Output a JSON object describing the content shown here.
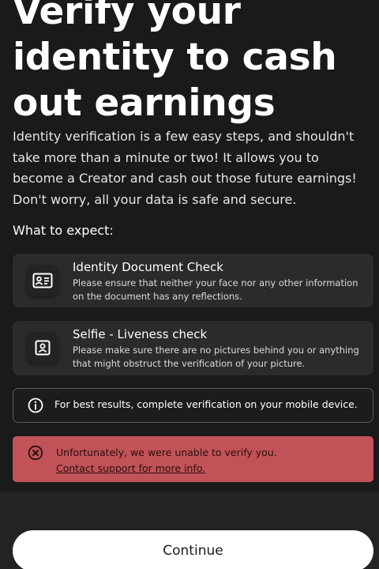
{
  "header": {
    "title": "Verify your identity to cash out earnings"
  },
  "intro": {
    "text": "Identity verification is a few easy steps, and shouldn't take more than a minute or two! It allows you to become a Creator and cash out those future earnings! Don't worry, all your data is safe and secure."
  },
  "expect": {
    "heading": "What to expect:",
    "items": [
      {
        "icon": "id-card-icon",
        "title": "Identity Document Check",
        "description": "Please ensure that neither your face nor any other information on the document has any reflections."
      },
      {
        "icon": "selfie-portrait-icon",
        "title": "Selfie - Liveness check",
        "description": "Please make sure there are no pictures behind you or anything that might obstruct the verification of your picture."
      }
    ]
  },
  "info": {
    "icon": "info-icon",
    "text": "For best results, complete verification on your mobile device."
  },
  "error": {
    "icon": "error-x-circle-icon",
    "message": "Unfortunately, we were unable to verify you.",
    "link_text": "Contact support for more info.",
    "color": "#c15258"
  },
  "footer": {
    "continue_label": "Continue"
  }
}
